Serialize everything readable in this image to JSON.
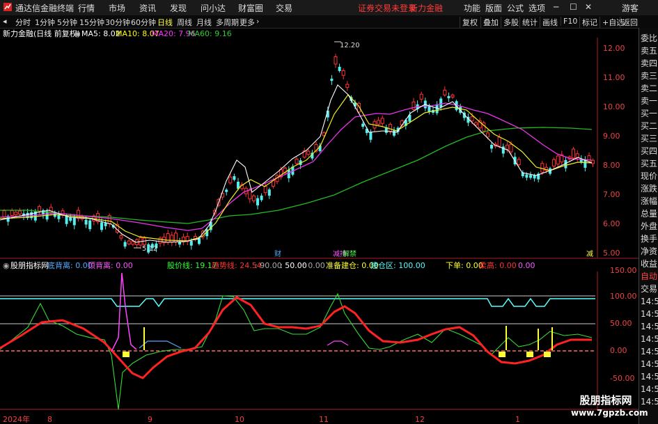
{
  "titlebar": {
    "app_name": "通达信金融终端",
    "menus": [
      "行情",
      "市场",
      "资讯",
      "发现",
      "问小达",
      "财富圈",
      "交易"
    ],
    "notice": "证券交易未登录",
    "stock_tag": "新力金融",
    "right_menus": [
      "功能",
      "版面",
      "公式",
      "选项"
    ],
    "guest": "游客",
    "minimize": "─",
    "maximize": "☐",
    "close": "✕"
  },
  "periods": {
    "items": [
      "分时",
      "1分钟",
      "5分钟",
      "15分钟",
      "30分钟",
      "60分钟",
      "日线",
      "周线",
      "月线",
      "多周期",
      "更多"
    ],
    "selected": "日线",
    "tools": [
      "复权",
      "叠加",
      "多股",
      "统计",
      "画线",
      "F10",
      "标记",
      "+自选",
      "返回"
    ]
  },
  "kline": {
    "stock_label": "新力金融(日线 前复权)",
    "ma": [
      {
        "label": "MA5: 8.02",
        "color": "#ffffff"
      },
      {
        "label": "MA10: 8.07",
        "color": "#ffff00"
      },
      {
        "label": "MA20: 7.96",
        "color": "#ff33ff"
      },
      {
        "label": "MA60: 9.16",
        "color": "#33cc33"
      }
    ],
    "price_ticks": [
      "12.00",
      "11.00",
      "10.00",
      "9.00",
      "8.00",
      "7.00",
      "6.00",
      "5.00"
    ],
    "high_label": "12.20",
    "low_label": "5.12",
    "events": [
      "财",
      "减持",
      "解禁",
      "减"
    ]
  },
  "indicator": {
    "name": "股朋指标网",
    "fields": [
      {
        "label": "底背离: 0.00",
        "color": "#55aaff"
      },
      {
        "label": "顶背离: 0.00",
        "color": "#ff55ff"
      },
      {
        "label": "股价线: 19.17",
        "color": "#33ff33"
      },
      {
        "label": "趋势线: 24.54",
        "color": "#ff3333"
      },
      {
        "label": ": 90.00",
        "color": "#aaaaaa"
      },
      {
        "label": ": 50.00",
        "color": "#ffffff"
      },
      {
        "label": ": 0.00",
        "color": "#aaaaaa"
      },
      {
        "label": "准备建仓: 0.00",
        "color": "#ffff33"
      },
      {
        "label": "建仓区: 100.00",
        "color": "#55ffff"
      },
      {
        "label": "下单: 0.00",
        "color": "#ffff33"
      },
      {
        "label": "柔高: 0.00",
        "color": "#ff3333"
      },
      {
        "label": "0.00",
        "color": "#ff55ff"
      }
    ],
    "ticks": [
      "150.00",
      "100.00",
      "50.00",
      "0.00",
      "-50.00"
    ]
  },
  "dates": [
    "2024年",
    "8",
    "9",
    "10",
    "11",
    "12",
    "1"
  ],
  "right_panel": {
    "items": [
      "委比",
      "卖五",
      "卖四",
      "卖三",
      "卖二",
      "卖一",
      "买一",
      "买二",
      "买三",
      "买四",
      "买五",
      "现价",
      "涨跌",
      "涨幅",
      "总量",
      "外盘",
      "换手",
      "净资",
      "收益",
      "自动",
      "交易",
      "14:5",
      "14:5",
      "14:5",
      "14:5",
      "14:5",
      "14:5",
      "14:5",
      "14:5",
      "14:5"
    ]
  },
  "watermark": {
    "line1": "股朋指标网",
    "line2": "www.7gpzb.com"
  }
}
